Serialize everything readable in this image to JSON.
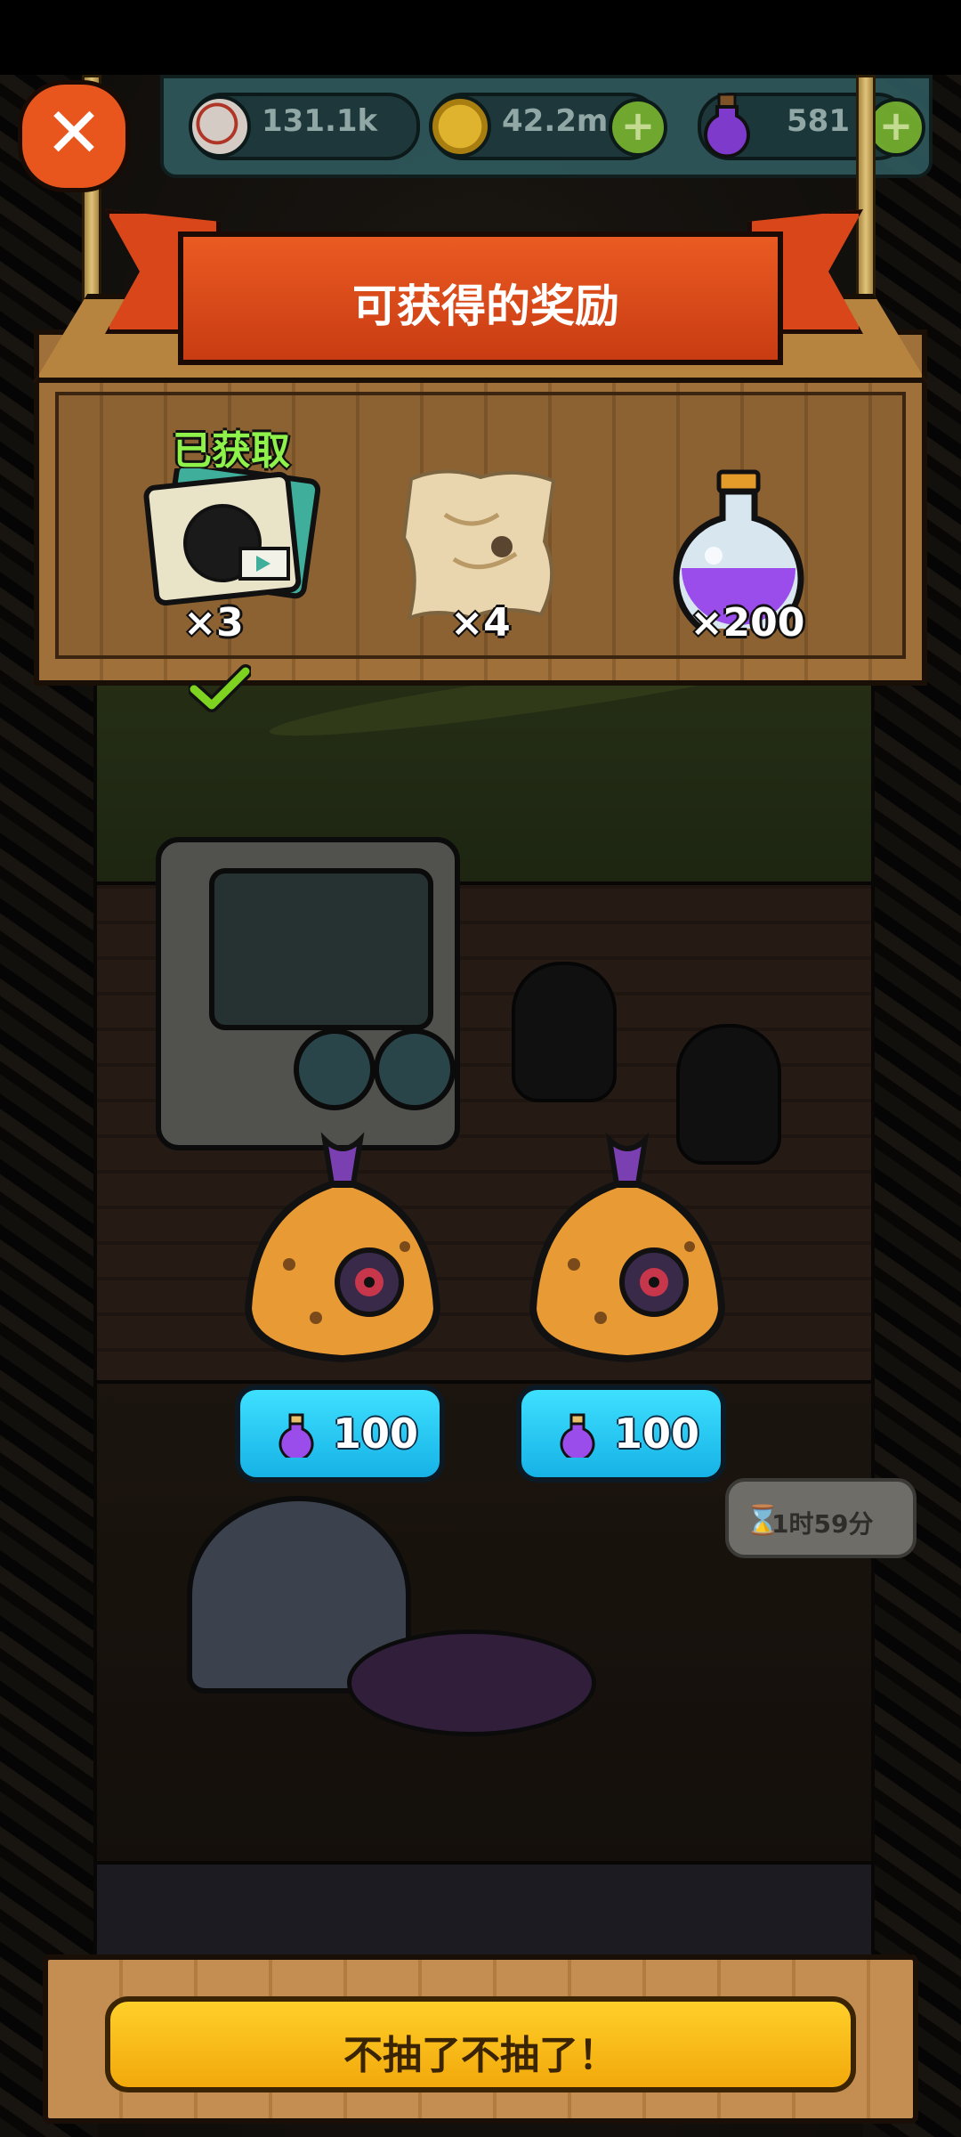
{
  "hud": {
    "eyes": {
      "icon": "eyeball-icon",
      "value": "131.1k"
    },
    "coins": {
      "icon": "coin-icon",
      "value": "42.2m",
      "add_icon": "plus-icon"
    },
    "potions": {
      "icon": "purple-potion-icon",
      "value": "581",
      "add_icon": "plus-icon"
    }
  },
  "close_button": {
    "icon": "close-icon"
  },
  "banner": {
    "title": "可获得的奖励"
  },
  "rewards": {
    "obtained_label": "已获取",
    "items": [
      {
        "icon": "card-pack-icon",
        "quantity": "×3",
        "obtained": true,
        "check_icon": "checkmark-icon"
      },
      {
        "icon": "treasure-map-scroll-icon",
        "quantity": "×4",
        "obtained": false
      },
      {
        "icon": "purple-potion-flask-icon",
        "quantity": "×200",
        "obtained": false
      }
    ]
  },
  "bags": [
    {
      "icon": "mystery-bag-icon",
      "price_icon": "purple-potion-icon",
      "price": "100"
    },
    {
      "icon": "mystery-bag-icon",
      "price_icon": "purple-potion-icon",
      "price": "100"
    }
  ],
  "timer": {
    "icon": "hourglass-icon",
    "text": "1时59分"
  },
  "footer": {
    "quit_label": "不抽了不抽了！"
  },
  "colors": {
    "ribbon": "#d9461a",
    "price_button": "#16b2e6",
    "quit_button": "#f2a90b",
    "obtained_text": "#8ef24a",
    "potion_purple": "#8a3fe0"
  }
}
